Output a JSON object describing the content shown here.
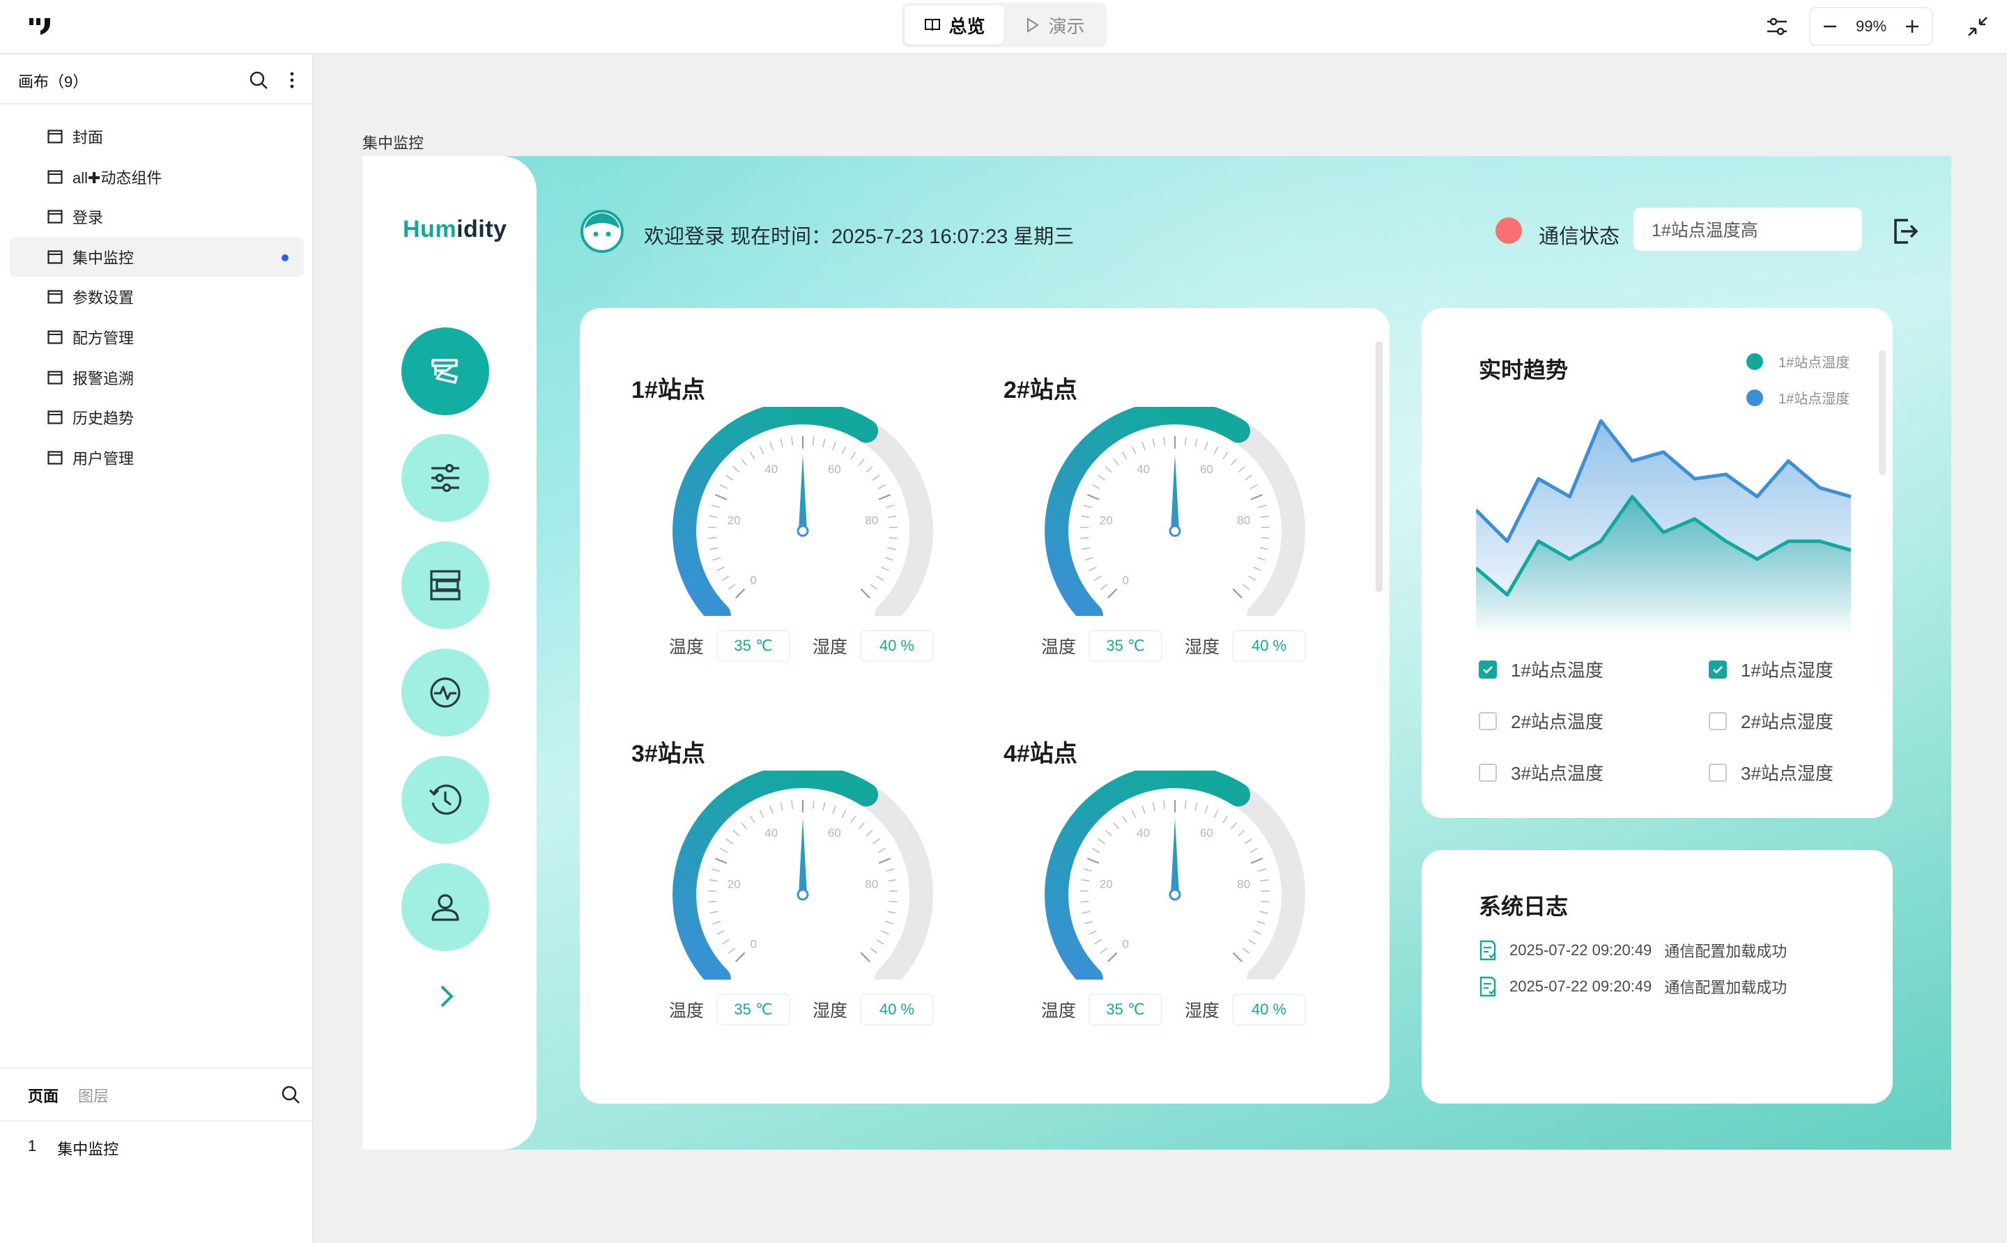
{
  "topbar": {
    "modes": [
      {
        "label": "总览",
        "active": true,
        "icon": "book-icon"
      },
      {
        "label": "演示",
        "active": false,
        "icon": "play-icon"
      }
    ],
    "zoom": "99%"
  },
  "left_panel": {
    "title": "画布（9）",
    "pages": [
      {
        "label": "封面"
      },
      {
        "label": "all✚动态组件"
      },
      {
        "label": "登录"
      },
      {
        "label": "集中监控",
        "selected": true
      },
      {
        "label": "参数设置"
      },
      {
        "label": "配方管理"
      },
      {
        "label": "报警追溯"
      },
      {
        "label": "历史趋势"
      },
      {
        "label": "用户管理"
      }
    ],
    "bottom_tabs": [
      {
        "label": "页面",
        "active": true
      },
      {
        "label": "图层",
        "active": false
      }
    ],
    "current_page": {
      "index": "1",
      "name": "集中监控"
    }
  },
  "canvas": {
    "frame_label": "集中监控",
    "brand": {
      "part1": "Hum",
      "part2": "idity"
    },
    "welcome": "欢迎登录  现在时间：2025-7-23  16:07:23 星期三",
    "comm_status": "通信状态",
    "alarm_text": "1#站点温度高",
    "colors": {
      "accent": "#13a89e",
      "blue": "#3b8fd8",
      "status_red": "#f87171"
    },
    "nav_icons": [
      "monitor-icon",
      "sliders-icon",
      "recipe-icon",
      "alarm-pulse-icon",
      "history-icon",
      "user-icon"
    ],
    "stations": [
      {
        "title": "1#站点",
        "temp_label": "温度",
        "temp": "35 ℃",
        "hum_label": "湿度",
        "hum": "40 %",
        "needle": 35
      },
      {
        "title": "2#站点",
        "temp_label": "温度",
        "temp": "35 ℃",
        "hum_label": "湿度",
        "hum": "40 %",
        "needle": 35
      },
      {
        "title": "3#站点",
        "temp_label": "温度",
        "temp": "35 ℃",
        "hum_label": "湿度",
        "hum": "40 %",
        "needle": 35
      },
      {
        "title": "4#站点",
        "temp_label": "温度",
        "temp": "35 ℃",
        "hum_label": "湿度",
        "hum": "40 %",
        "needle": 35
      }
    ],
    "gauge": {
      "min": 0,
      "max": 100,
      "value": 35,
      "ticks": [
        "0",
        "20",
        "40",
        "60",
        "80"
      ]
    },
    "trend": {
      "title": "实时趋势",
      "legend": [
        {
          "name": "1#站点温度",
          "color": "#13a89e"
        },
        {
          "name": "1#站点湿度",
          "color": "#3b8fd8"
        }
      ],
      "series_checks": [
        {
          "label": "1#站点温度",
          "checked": true
        },
        {
          "label": "1#站点湿度",
          "checked": true
        },
        {
          "label": "2#站点温度",
          "checked": false
        },
        {
          "label": "2#站点湿度",
          "checked": false
        },
        {
          "label": "3#站点温度",
          "checked": false
        },
        {
          "label": "3#站点湿度",
          "checked": false
        }
      ]
    },
    "log": {
      "title": "系统日志",
      "entries": [
        {
          "time": "2025-07-22 09:20:49",
          "message": "通信配置加载成功"
        },
        {
          "time": "2025-07-22 09:20:49",
          "message": "通信配置加载成功"
        }
      ]
    }
  },
  "chart_data": {
    "type": "area",
    "x": [
      1,
      2,
      3,
      4,
      5,
      6,
      7,
      8,
      9,
      10,
      11,
      12,
      13
    ],
    "series": [
      {
        "name": "1#站点湿度",
        "values": [
          45,
          38,
          52,
          48,
          65,
          56,
          58,
          52,
          53,
          48,
          56,
          50,
          48
        ]
      },
      {
        "name": "1#站点温度",
        "values": [
          32,
          26,
          38,
          34,
          38,
          48,
          40,
          43,
          38,
          34,
          38,
          38,
          36
        ]
      }
    ],
    "ylim": [
      20,
      70
    ],
    "grid": false,
    "legend": "top-right"
  }
}
